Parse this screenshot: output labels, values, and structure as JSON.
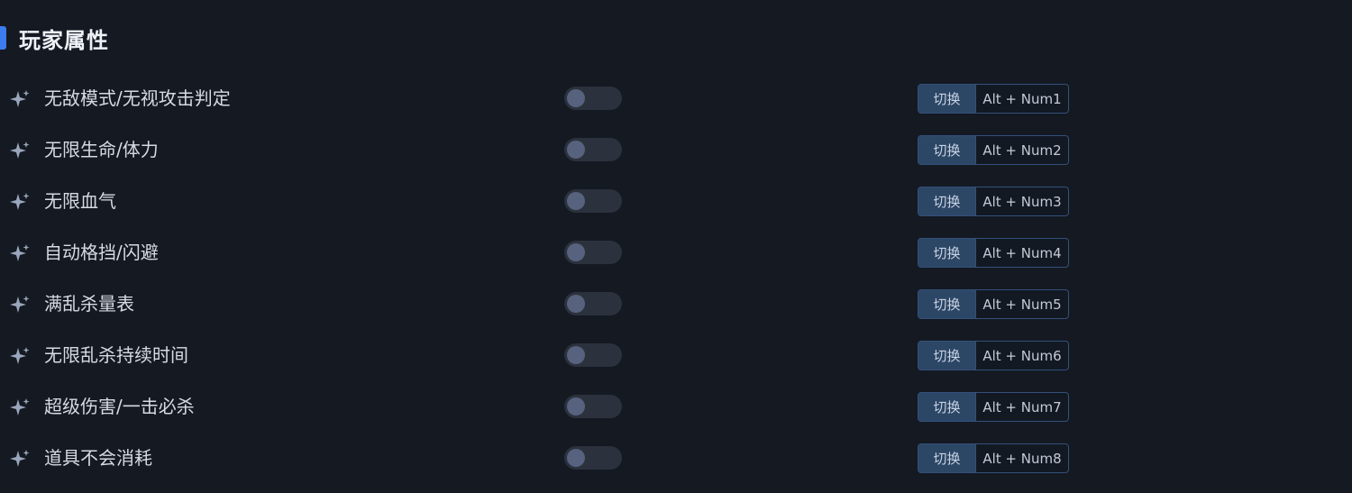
{
  "section": {
    "title": "玩家属性"
  },
  "colors": {
    "accent": "#3d7bf0",
    "background": "#141922",
    "toggle_track": "#2c323d",
    "toggle_knob": "#57627e",
    "hotkey_button": "#2c4666"
  },
  "icons": {
    "row_icon": "sparkle-icon"
  },
  "rows": [
    {
      "label": "无敌模式/无视攻击判定",
      "enabled": false,
      "action": "切换",
      "hotkey": "Alt + Num1"
    },
    {
      "label": "无限生命/体力",
      "enabled": false,
      "action": "切换",
      "hotkey": "Alt + Num2"
    },
    {
      "label": "无限血气",
      "enabled": false,
      "action": "切换",
      "hotkey": "Alt + Num3"
    },
    {
      "label": "自动格挡/闪避",
      "enabled": false,
      "action": "切换",
      "hotkey": "Alt + Num4"
    },
    {
      "label": "满乱杀量表",
      "enabled": false,
      "action": "切换",
      "hotkey": "Alt + Num5"
    },
    {
      "label": "无限乱杀持续时间",
      "enabled": false,
      "action": "切换",
      "hotkey": "Alt + Num6"
    },
    {
      "label": "超级伤害/一击必杀",
      "enabled": false,
      "action": "切换",
      "hotkey": "Alt + Num7"
    },
    {
      "label": "道具不会消耗",
      "enabled": false,
      "action": "切换",
      "hotkey": "Alt + Num8"
    }
  ]
}
